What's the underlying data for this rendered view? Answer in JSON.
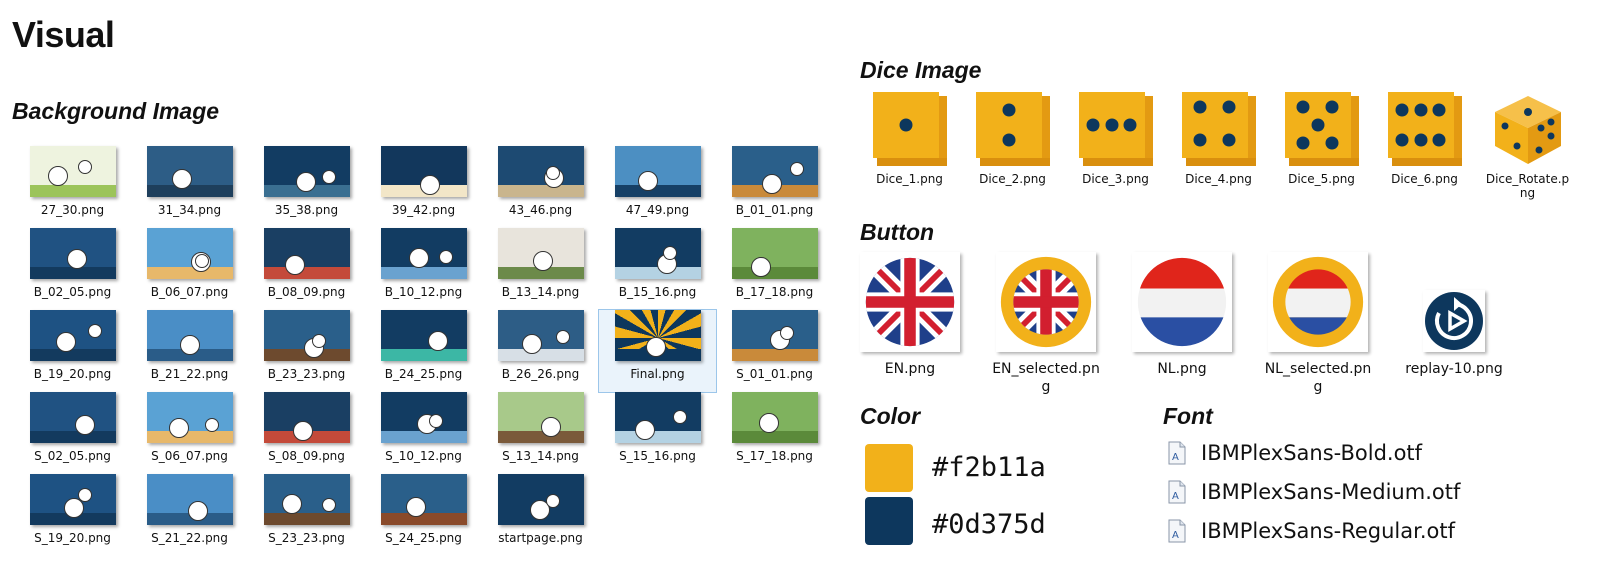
{
  "page": {
    "title": "Visual"
  },
  "sections": {
    "background": "Background Image",
    "dice": "Dice Image",
    "button": "Button",
    "color": "Color",
    "font": "Font"
  },
  "backgrounds": [
    {
      "name": "27_30.png",
      "bg": "#eef3df",
      "ground": "#9cc45a"
    },
    {
      "name": "31_34.png",
      "bg": "#2d5d86",
      "ground": "#1e3f5c"
    },
    {
      "name": "35_38.png",
      "bg": "#123c62",
      "ground": "#3a6f91"
    },
    {
      "name": "39_42.png",
      "bg": "#12375c",
      "ground": "#f2e6c8"
    },
    {
      "name": "43_46.png",
      "bg": "#1d4a72",
      "ground": "#c9b58d"
    },
    {
      "name": "47_49.png",
      "bg": "#4c8fc2",
      "ground": "#164066"
    },
    {
      "name": "B_01_01.png",
      "bg": "#2a5f8a",
      "ground": "#c98a3a"
    },
    {
      "name": "B_02_05.png",
      "bg": "#205282",
      "ground": "#133a5e"
    },
    {
      "name": "B_06_07.png",
      "bg": "#5aa2d4",
      "ground": "#e7b86a"
    },
    {
      "name": "B_08_09.png",
      "bg": "#1a3f63",
      "ground": "#c44a3a"
    },
    {
      "name": "B_10_12.png",
      "bg": "#123c62",
      "ground": "#6aa2cf"
    },
    {
      "name": "B_13_14.png",
      "bg": "#e8e4dc",
      "ground": "#6c8a4a"
    },
    {
      "name": "B_15_16.png",
      "bg": "#123c62",
      "ground": "#b4d2e3"
    },
    {
      "name": "B_17_18.png",
      "bg": "#7fb25e",
      "ground": "#5b8a3a"
    },
    {
      "name": "B_19_20.png",
      "bg": "#1e5283",
      "ground": "#133a5e"
    },
    {
      "name": "B_21_22.png",
      "bg": "#4a8ec6",
      "ground": "#2a5c88"
    },
    {
      "name": "B_23_23.png",
      "bg": "#2a5f8a",
      "ground": "#6d4a2e"
    },
    {
      "name": "B_24_25.png",
      "bg": "#123c62",
      "ground": "#3cb7a5"
    },
    {
      "name": "B_26_26.png",
      "bg": "#2d5d86",
      "ground": "#d7dfe6"
    },
    {
      "name": "Final.png",
      "bg": "#f2b11a",
      "ground": "#0d375d"
    },
    {
      "name": "S_01_01.png",
      "bg": "#2a5f8a",
      "ground": "#c98a3a"
    },
    {
      "name": "S_02_05.png",
      "bg": "#205282",
      "ground": "#133a5e"
    },
    {
      "name": "S_06_07.png",
      "bg": "#5aa2d4",
      "ground": "#e7b86a"
    },
    {
      "name": "S_08_09.png",
      "bg": "#1a3f63",
      "ground": "#c44a3a"
    },
    {
      "name": "S_10_12.png",
      "bg": "#123c62",
      "ground": "#6aa2cf"
    },
    {
      "name": "S_13_14.png",
      "bg": "#a8c98a",
      "ground": "#7a5a3a"
    },
    {
      "name": "S_15_16.png",
      "bg": "#123c62",
      "ground": "#b4d2e3"
    },
    {
      "name": "S_17_18.png",
      "bg": "#7fb25e",
      "ground": "#5b8a3a"
    },
    {
      "name": "S_19_20.png",
      "bg": "#1e5283",
      "ground": "#133a5e"
    },
    {
      "name": "S_21_22.png",
      "bg": "#4a8ec6",
      "ground": "#2a5c88"
    },
    {
      "name": "S_23_23.png",
      "bg": "#2a5f8a",
      "ground": "#6d4a2e"
    },
    {
      "name": "S_24_25.png",
      "bg": "#2a5f8a",
      "ground": "#8a4a2a"
    },
    {
      "name": "startpage.png",
      "bg": "#123c62",
      "ground": "#123c62"
    }
  ],
  "selected_background": "Final.png",
  "dice": [
    {
      "name": "Dice_1.png",
      "pips": 1
    },
    {
      "name": "Dice_2.png",
      "pips": 2
    },
    {
      "name": "Dice_3.png",
      "pips": 3
    },
    {
      "name": "Dice_4.png",
      "pips": 4
    },
    {
      "name": "Dice_5.png",
      "pips": 5
    },
    {
      "name": "Dice_6.png",
      "pips": 6
    },
    {
      "name": "Dice_Rotate.png",
      "pips": 0
    }
  ],
  "buttons": [
    {
      "name": "EN.png",
      "icon": "uk-flag-icon"
    },
    {
      "name": "EN_selected.png",
      "icon": "uk-flag-selected-icon"
    },
    {
      "name": "NL.png",
      "icon": "nl-flag-icon"
    },
    {
      "name": "NL_selected.png",
      "icon": "nl-flag-selected-icon"
    },
    {
      "name": "replay-10.png",
      "icon": "replay-icon"
    }
  ],
  "colors": [
    {
      "hex": "#f2b11a"
    },
    {
      "hex": "#0d375d"
    }
  ],
  "fonts": [
    {
      "name": "IBMPlexSans-Bold.otf"
    },
    {
      "name": "IBMPlexSans-Medium.otf"
    },
    {
      "name": "IBMPlexSans-Regular.otf"
    }
  ]
}
